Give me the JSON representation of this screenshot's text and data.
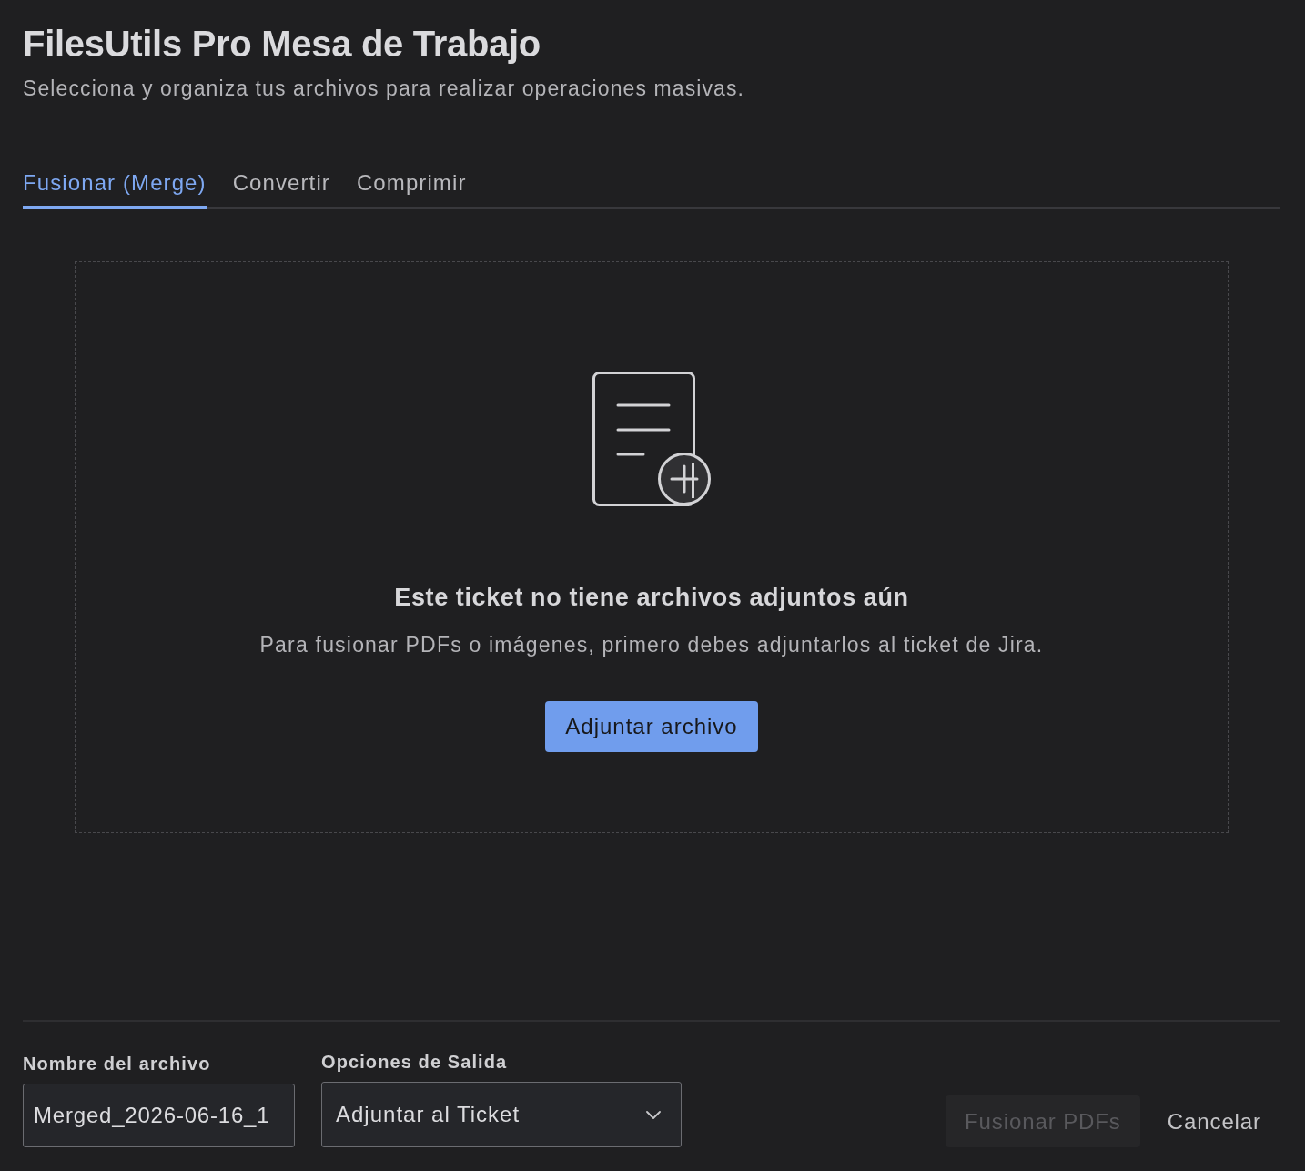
{
  "page": {
    "title": "FilesUtils Pro Mesa de Trabajo",
    "subtitle": "Selecciona y organiza tus archivos para realizar operaciones masivas."
  },
  "tabs": [
    {
      "label": "Fusionar (Merge)",
      "selected": true
    },
    {
      "label": "Convertir",
      "selected": false
    },
    {
      "label": "Comprimir",
      "selected": false
    }
  ],
  "empty_state": {
    "heading": "Este ticket no tiene archivos adjuntos aún",
    "message": "Para fusionar PDFs o imágenes, primero debes adjuntarlos al ticket de Jira.",
    "button": "Adjuntar archivo"
  },
  "footer": {
    "file_name": {
      "label": "Nombre del archivo",
      "value": "Merged_2026-06-16_1"
    },
    "output": {
      "label": "Opciones de Salida",
      "value": "Adjuntar al Ticket"
    },
    "buttons": [
      {
        "label": "Fusionar PDFs",
        "kind": "primary",
        "disabled": true
      },
      {
        "label": "Cancelar",
        "kind": "subtle",
        "disabled": false
      }
    ]
  }
}
